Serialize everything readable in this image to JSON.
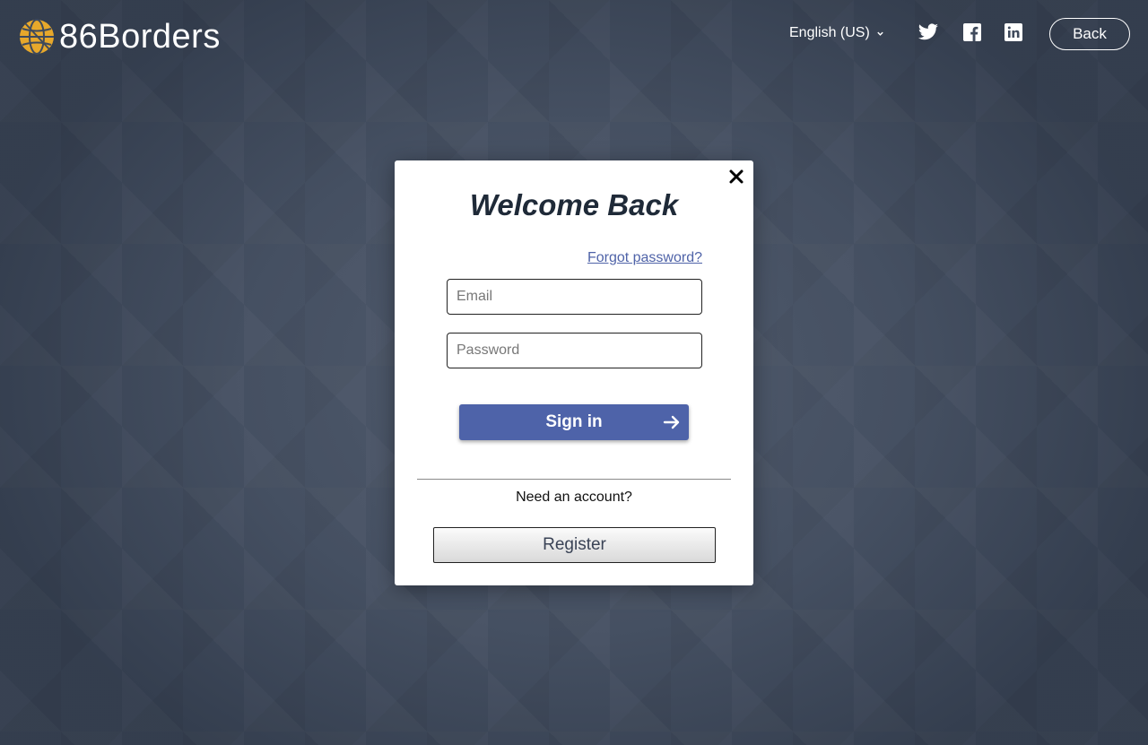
{
  "header": {
    "logo_text": "86Borders",
    "logo_icon": "globe-icon",
    "language": "English (US)",
    "social_icons": [
      "twitter-icon",
      "facebook-icon",
      "linkedin-icon"
    ],
    "back_label": "Back"
  },
  "modal": {
    "title": "Welcome Back",
    "forgot_password": "Forgot password?",
    "email_placeholder": "Email",
    "email_value": "",
    "password_placeholder": "Password",
    "password_value": "",
    "signin_label": "Sign in",
    "need_account": "Need an account?",
    "register_label": "Register"
  },
  "colors": {
    "background": "#3f4a5c",
    "accent": "#4e63a9",
    "logo_gold": "#e7a82b",
    "title": "#1f2a38"
  }
}
